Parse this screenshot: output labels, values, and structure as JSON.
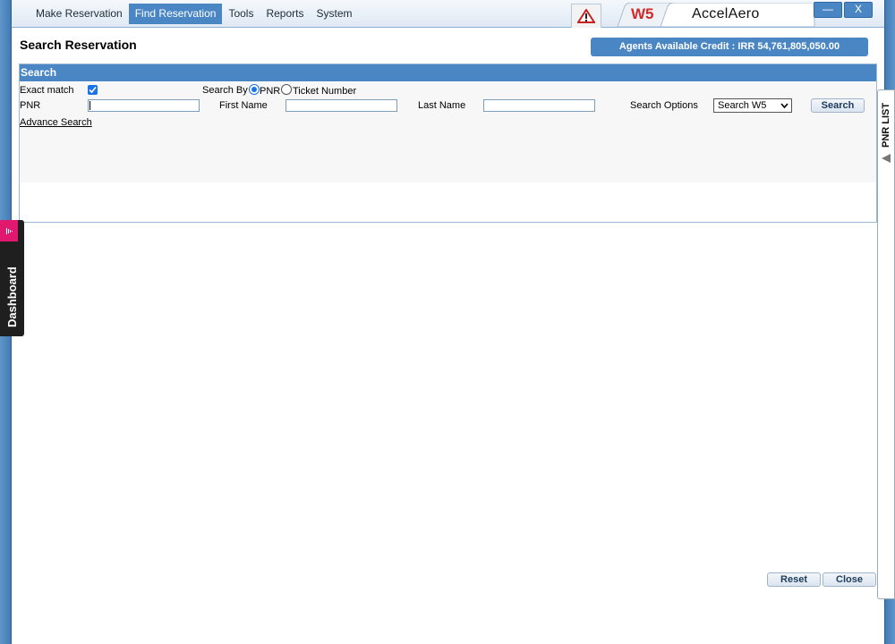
{
  "menu": {
    "items": [
      "Make Reservation",
      "Find Reservation",
      "Tools",
      "Reports",
      "System"
    ],
    "active_index": 1
  },
  "header": {
    "carrier_code": "W5",
    "brand": "AccelAero",
    "minimize_label": "—",
    "close_label": "X"
  },
  "page": {
    "title": "Search Reservation",
    "credit_text": "Agents Available Credit : IRR 54,761,805,050.00"
  },
  "search": {
    "panel_title": "Search",
    "exact_match_label": "Exact match",
    "exact_match_checked": true,
    "search_by_label": "Search By",
    "pnr_option_label": "PNR",
    "ticket_option_label": "Ticket Number",
    "search_by_selected": "PNR",
    "pnr_label": "PNR",
    "pnr_value": "",
    "first_name_label": "First Name",
    "first_name_value": "",
    "last_name_label": "Last Name",
    "last_name_value": "",
    "options_label": "Search Options",
    "options_selected": "Search W5",
    "search_button": "Search",
    "advance_search_link": "Advance Search"
  },
  "footer": {
    "reset_button": "Reset",
    "close_button": "Close"
  },
  "side_tabs": {
    "dashboard": "Dashboard",
    "pnr_list": "PNR LIST"
  },
  "colors": {
    "accent": "#4b86c4",
    "frame": "#4f8ac4",
    "carrier": "#d02a2a",
    "dashboard_pink": "#e0196e"
  }
}
